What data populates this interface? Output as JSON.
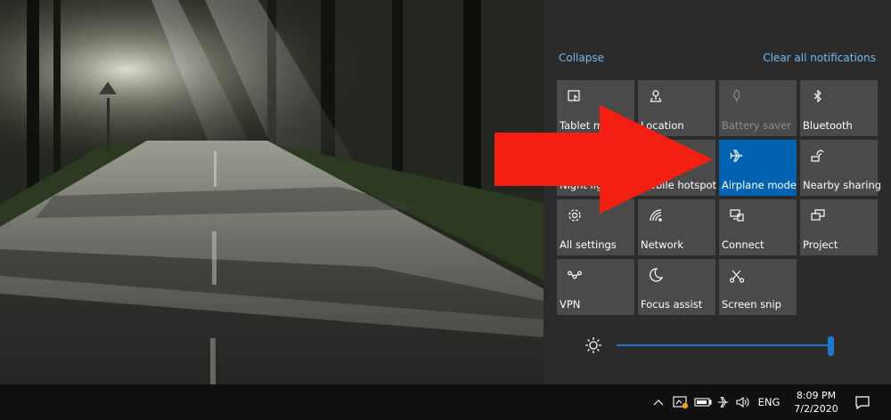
{
  "action_center": {
    "collapse_label": "Collapse",
    "clear_label": "Clear all notifications",
    "tiles": [
      {
        "label": "Tablet mode",
        "icon": "tablet-mode-icon",
        "state": "off"
      },
      {
        "label": "Location",
        "icon": "location-icon",
        "state": "off"
      },
      {
        "label": "Battery saver",
        "icon": "battery-saver-icon",
        "state": "disabled"
      },
      {
        "label": "Bluetooth",
        "icon": "bluetooth-icon",
        "state": "off"
      },
      {
        "label": "Night light",
        "icon": "night-light-icon",
        "state": "off"
      },
      {
        "label": "Mobile hotspot",
        "icon": "mobile-hotspot-icon",
        "state": "off"
      },
      {
        "label": "Airplane mode",
        "icon": "airplane-icon",
        "state": "on"
      },
      {
        "label": "Nearby sharing",
        "icon": "nearby-sharing-icon",
        "state": "off"
      },
      {
        "label": "All settings",
        "icon": "settings-gear-icon",
        "state": "off"
      },
      {
        "label": "Network",
        "icon": "network-icon",
        "state": "off"
      },
      {
        "label": "Connect",
        "icon": "connect-icon",
        "state": "off"
      },
      {
        "label": "Project",
        "icon": "project-icon",
        "state": "off"
      },
      {
        "label": "VPN",
        "icon": "vpn-icon",
        "state": "off"
      },
      {
        "label": "Focus assist",
        "icon": "focus-assist-icon",
        "state": "off"
      },
      {
        "label": "Screen snip",
        "icon": "screen-snip-icon",
        "state": "off"
      }
    ],
    "brightness_level": 1.0
  },
  "taskbar": {
    "language": "ENG",
    "time": "8:09 PM",
    "date": "7/2/2020"
  },
  "colors": {
    "panel_bg": "#2b2b2b",
    "tile_bg": "#4a4a4a",
    "tile_active": "#0063b1",
    "link": "#76b9ed",
    "accent": "#1e78d2",
    "arrow": "#f21f12"
  }
}
